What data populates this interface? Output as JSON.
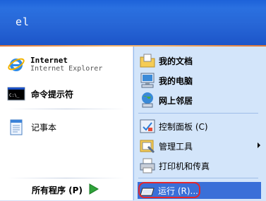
{
  "user": {
    "name": "el"
  },
  "pinned": [
    {
      "title": "Internet",
      "subtitle": "Internet Explorer",
      "icon": "internet-explorer-icon"
    },
    {
      "title": "命令提示符",
      "icon": "command-prompt-icon"
    }
  ],
  "recent": [
    {
      "title": "记事本",
      "icon": "notepad-icon"
    }
  ],
  "all_programs": {
    "label": "所有程序 (P)",
    "icon": "green-arrow-icon"
  },
  "right_items": [
    {
      "label": "我的文档",
      "icon": "my-documents-icon"
    },
    {
      "label": "我的电脑",
      "icon": "my-computer-icon"
    },
    {
      "label": "网上邻居",
      "icon": "network-places-icon"
    },
    {
      "label": "控制面板 (C)",
      "icon": "control-panel-icon"
    },
    {
      "label": "管理工具",
      "icon": "admin-tools-icon"
    },
    {
      "label": "打印机和传真",
      "icon": "printer-icon"
    }
  ],
  "run": {
    "label": "运行 (R)...",
    "icon": "run-icon"
  },
  "colors": {
    "header": "#2766d6",
    "accent": "#f7b46a",
    "right_panel": "#d3e5fa",
    "highlight": "#e5262a"
  }
}
